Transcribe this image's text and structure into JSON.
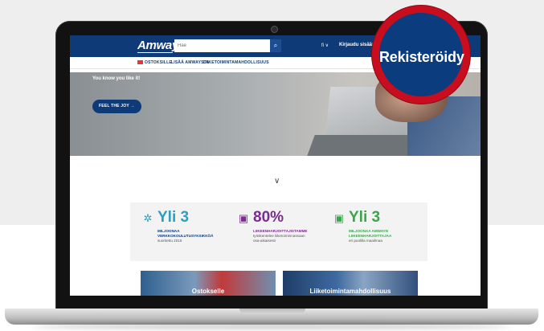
{
  "header": {
    "logo": "Amway",
    "search_placeholder": "Hae",
    "lang": "fi ∨",
    "login": "Kirjaudu sisään",
    "register_zoom": "Rekisteröidy"
  },
  "subnav": {
    "items": [
      "OSTOKSILLE",
      "LISÄÄ AMWAYSTA",
      "LIIKETOIMINTAMAHDOLLISUUS"
    ]
  },
  "hero": {
    "tagline": "You know you like it!",
    "cta": "FEEL THE JOY →"
  },
  "stats": [
    {
      "icon": "award-icon",
      "number": "Yli 3",
      "line1": "MILJOONAA",
      "line2": "VERKKOKOULUTUSYKSIKKÖÄ",
      "line3": "suoritettu 2015",
      "color": "#2a9fc0"
    },
    {
      "icon": "id-card-icon",
      "number": "80%",
      "line1": "LIIKEENHARJOITTAJISTAMME",
      "line2": "työskentelee liiketoiminnassaan",
      "line3": "osa-aikaisesti",
      "color": "#7b2c8f"
    },
    {
      "icon": "id-card-icon",
      "number": "Yli 3",
      "line1": "MILJOONAA AMWAYN",
      "line2": "LIIKEENHARJOITTAJAA",
      "line3": "eri puolilla maailmaa",
      "color": "#3aa64b"
    }
  ],
  "cards": [
    {
      "title": "Ostokselle"
    },
    {
      "title": "Liiketoimintamahdollisuus"
    }
  ],
  "colors": {
    "brand_blue": "#0f3a78",
    "badge_red": "#c80e1e"
  }
}
